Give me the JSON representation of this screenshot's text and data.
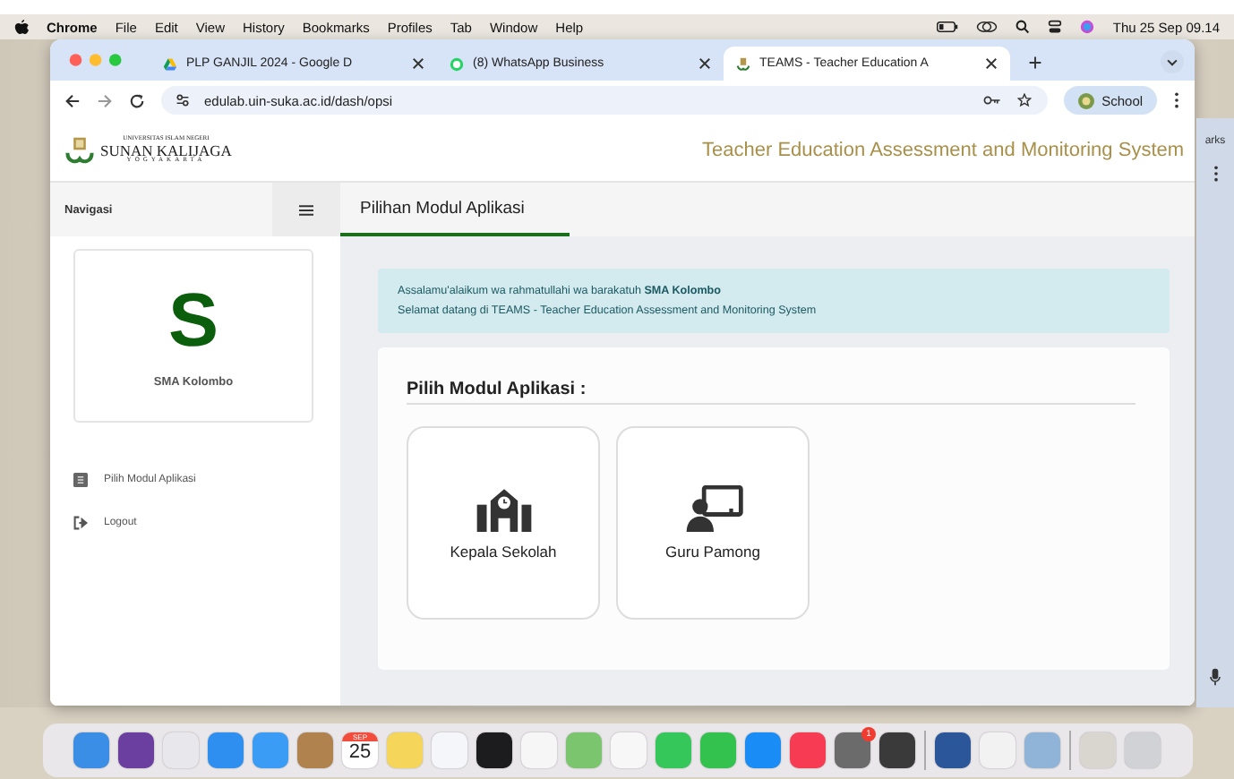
{
  "menu_bar": {
    "app": "Chrome",
    "items": [
      "File",
      "Edit",
      "View",
      "History",
      "Bookmarks",
      "Profiles",
      "Tab",
      "Window",
      "Help"
    ],
    "clock": "Thu 25 Sep 09.14"
  },
  "browser": {
    "tabs": [
      {
        "title": "PLP GANJIL 2024 - Google D",
        "selected": false,
        "kind": "drive"
      },
      {
        "title": "(8) WhatsApp Business",
        "selected": false,
        "kind": "whatsapp"
      },
      {
        "title": "TEAMS - Teacher Education A",
        "selected": true,
        "kind": "site"
      }
    ],
    "url": "edulab.uin-suka.ac.id/dash/opsi",
    "profile": "School"
  },
  "header": {
    "logo_lines": [
      "UNIVERSITAS ISLAM NEGERI",
      "SUNAN KALIJAGA",
      "YOGYAKARTA"
    ],
    "system_title": "Teacher Education Assessment and Monitoring System"
  },
  "sidebar": {
    "title": "Navigasi",
    "avatar_letter": "S",
    "school": "SMA Kolombo",
    "items": [
      {
        "label": "Pilih Modul Aplikasi",
        "kind": "list"
      },
      {
        "label": "Logout",
        "kind": "logout"
      }
    ]
  },
  "page": {
    "tab": "Pilihan Modul Aplikasi",
    "alert": [
      "Assalamu'alaikum wa rahmatullahi wa barakatuh **SMA Kolombo**",
      "Selamat datang di TEAMS - Teacher Education Assessment and Monitoring System"
    ],
    "modules_title": "Pilih Modul Aplikasi :",
    "modules": [
      {
        "label": "Kepala Sekolah",
        "kind": "principal"
      },
      {
        "label": "Guru Pamong",
        "kind": "teacher"
      }
    ]
  },
  "background_window": {
    "text": "arks"
  },
  "dock": [
    {
      "kind": "app",
      "color": "#3a8ee6"
    },
    {
      "kind": "app",
      "color": "#6b3fa0"
    },
    {
      "kind": "app",
      "color": "#e8e8ec"
    },
    {
      "kind": "app",
      "color": "#2f8ff0"
    },
    {
      "kind": "app",
      "color": "#3b9cf5"
    },
    {
      "kind": "app",
      "color": "#b0834e"
    },
    {
      "kind": "calendar",
      "color": "#ffffff",
      "month": "SEP",
      "day": "25"
    },
    {
      "kind": "app",
      "color": "#f6d65a"
    },
    {
      "kind": "app",
      "color": "#f4f6fa"
    },
    {
      "kind": "app",
      "color": "#1c1c1e"
    },
    {
      "kind": "app",
      "color": "#f6f6f6"
    },
    {
      "kind": "app",
      "color": "#7cc56f"
    },
    {
      "kind": "app",
      "color": "#f7f7f7"
    },
    {
      "kind": "app",
      "color": "#35c759"
    },
    {
      "kind": "app",
      "color": "#34c24f"
    },
    {
      "kind": "app",
      "color": "#1a8cf5"
    },
    {
      "kind": "app",
      "color": "#f63b53"
    },
    {
      "kind": "app",
      "color": "#6b6b6b",
      "badge": "1"
    },
    {
      "kind": "app",
      "color": "#3a3a3a"
    },
    {
      "kind": "separator"
    },
    {
      "kind": "app",
      "color": "#2b579a"
    },
    {
      "kind": "app",
      "color": "#f2f2f2"
    },
    {
      "kind": "app",
      "color": "#8fb4d8"
    },
    {
      "kind": "separator"
    },
    {
      "kind": "app",
      "color": "#d9d6cf"
    },
    {
      "kind": "app",
      "color": "#d0d2d6"
    }
  ]
}
